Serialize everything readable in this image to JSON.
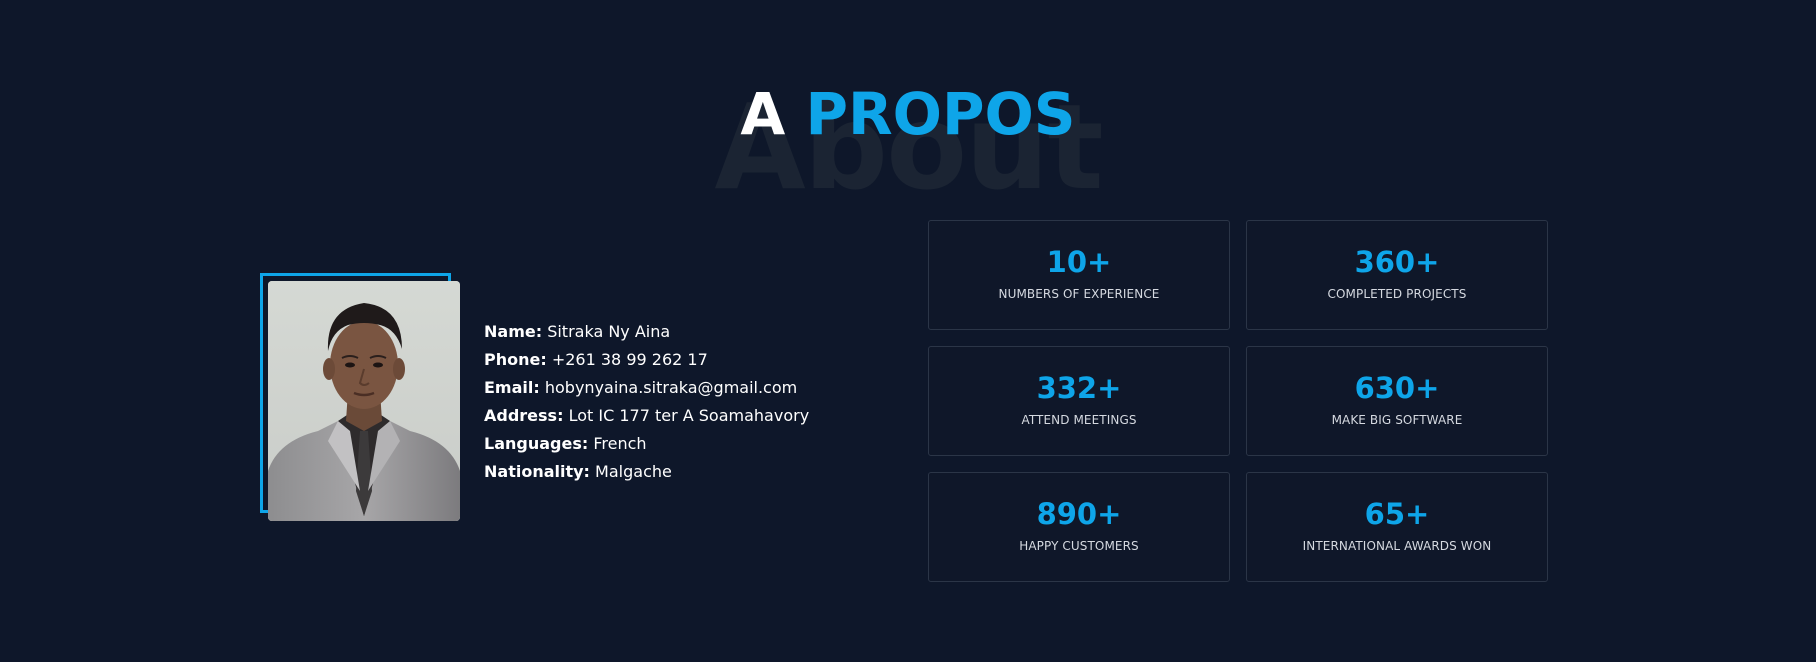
{
  "section": {
    "background_word": "About",
    "title_part1": "A",
    "title_part2": "PROPOS"
  },
  "profile": {
    "rows": [
      {
        "label": "Name:",
        "value": "Sitraka Ny Aina"
      },
      {
        "label": "Phone:",
        "value": "+261 38 99 262 17"
      },
      {
        "label": "Email:",
        "value": "hobynyaina.sitraka@gmail.com"
      },
      {
        "label": "Address:",
        "value": "Lot IC 177 ter A Soamahavory"
      },
      {
        "label": "Languages:",
        "value": "French"
      },
      {
        "label": "Nationality:",
        "value": "Malgache"
      }
    ]
  },
  "stats": [
    {
      "number": "10+",
      "label": "NUMBERS OF EXPERIENCE"
    },
    {
      "number": "360+",
      "label": "COMPLETED PROJECTS"
    },
    {
      "number": "332+",
      "label": "ATTEND MEETINGS"
    },
    {
      "number": "630+",
      "label": "MAKE BIG SOFTWARE"
    },
    {
      "number": "890+",
      "label": "HAPPY CUSTOMERS"
    },
    {
      "number": "65+",
      "label": "INTERNATIONAL AWARDS WON"
    }
  ],
  "colors": {
    "background": "#0e172a",
    "accent": "#0ea5e9",
    "card_border": "#2b3547",
    "background_word": "#1b2433"
  }
}
